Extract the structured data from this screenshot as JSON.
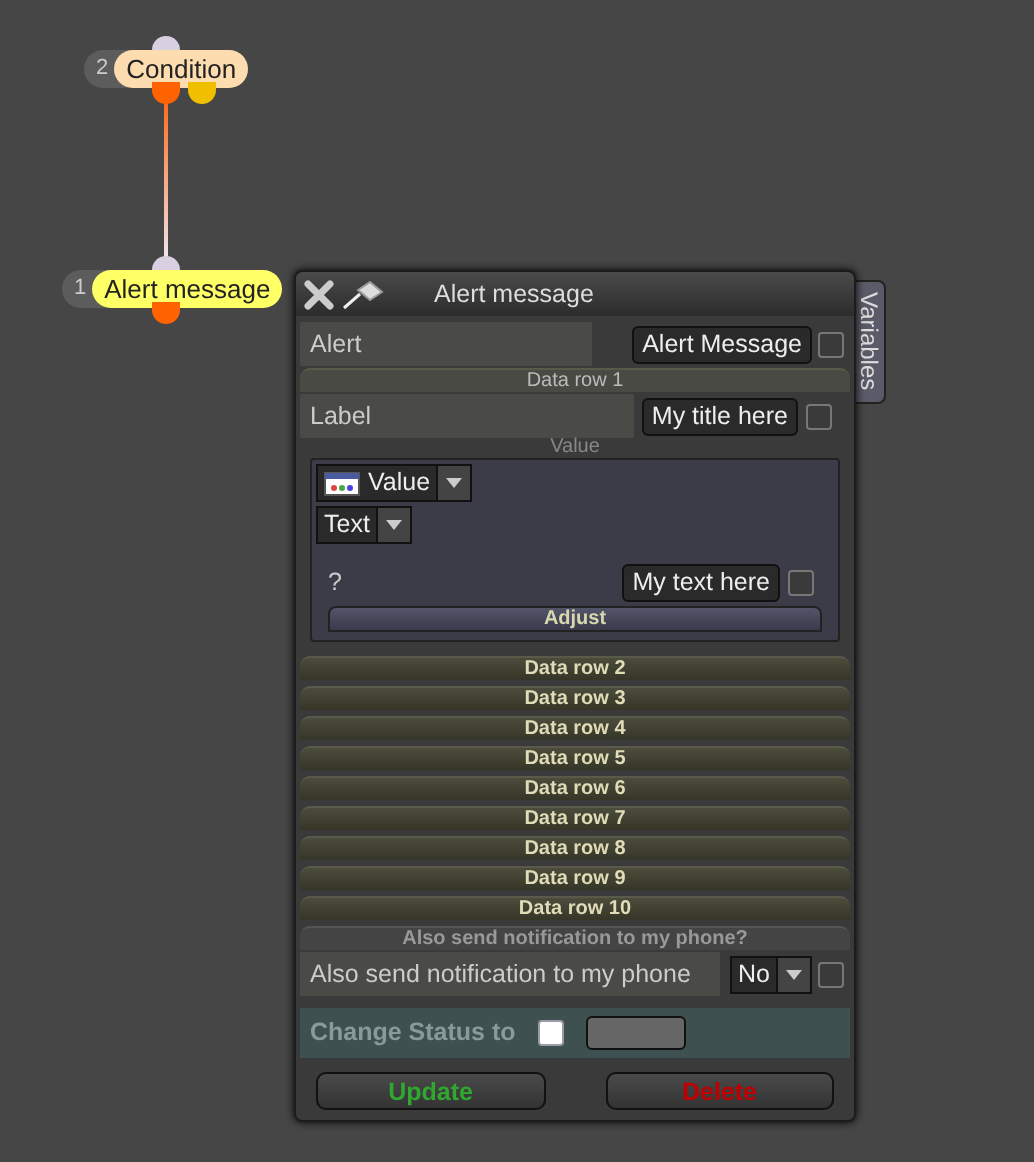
{
  "canvas": {
    "nodes": [
      {
        "number": "2",
        "label": "Condition",
        "color": "#fddcb0"
      },
      {
        "number": "1",
        "label": "Alert message",
        "color": "#ffff66"
      }
    ]
  },
  "panel": {
    "title": "Alert message",
    "side_tab": "Variables",
    "alert": {
      "label": "Alert",
      "value": "Alert Message",
      "checked": false
    },
    "data_rows": [
      {
        "title": "Data row 1",
        "expanded": true,
        "label": "Label",
        "value": "My title here",
        "checked": false,
        "value_section": {
          "heading": "Value",
          "type_dropdown": "Value",
          "format_dropdown": "Text",
          "prompt": "?",
          "text": "My text here",
          "checked": false,
          "button": "Adjust"
        }
      },
      {
        "title": "Data row 2",
        "expanded": false
      },
      {
        "title": "Data row 3",
        "expanded": false
      },
      {
        "title": "Data row 4",
        "expanded": false
      },
      {
        "title": "Data row 5",
        "expanded": false
      },
      {
        "title": "Data row 6",
        "expanded": false
      },
      {
        "title": "Data row 7",
        "expanded": false
      },
      {
        "title": "Data row 8",
        "expanded": false
      },
      {
        "title": "Data row 9",
        "expanded": false
      },
      {
        "title": "Data row 10",
        "expanded": false
      }
    ],
    "notification": {
      "heading": "Also send notification to my phone?",
      "label": "Also send notification to my phone",
      "value": "No",
      "checked": false
    },
    "status": {
      "label": "Change Status to",
      "checked": false
    },
    "buttons": [
      {
        "label": "Update",
        "kind": "update"
      },
      {
        "label": "Delete",
        "kind": "delete"
      }
    ]
  }
}
